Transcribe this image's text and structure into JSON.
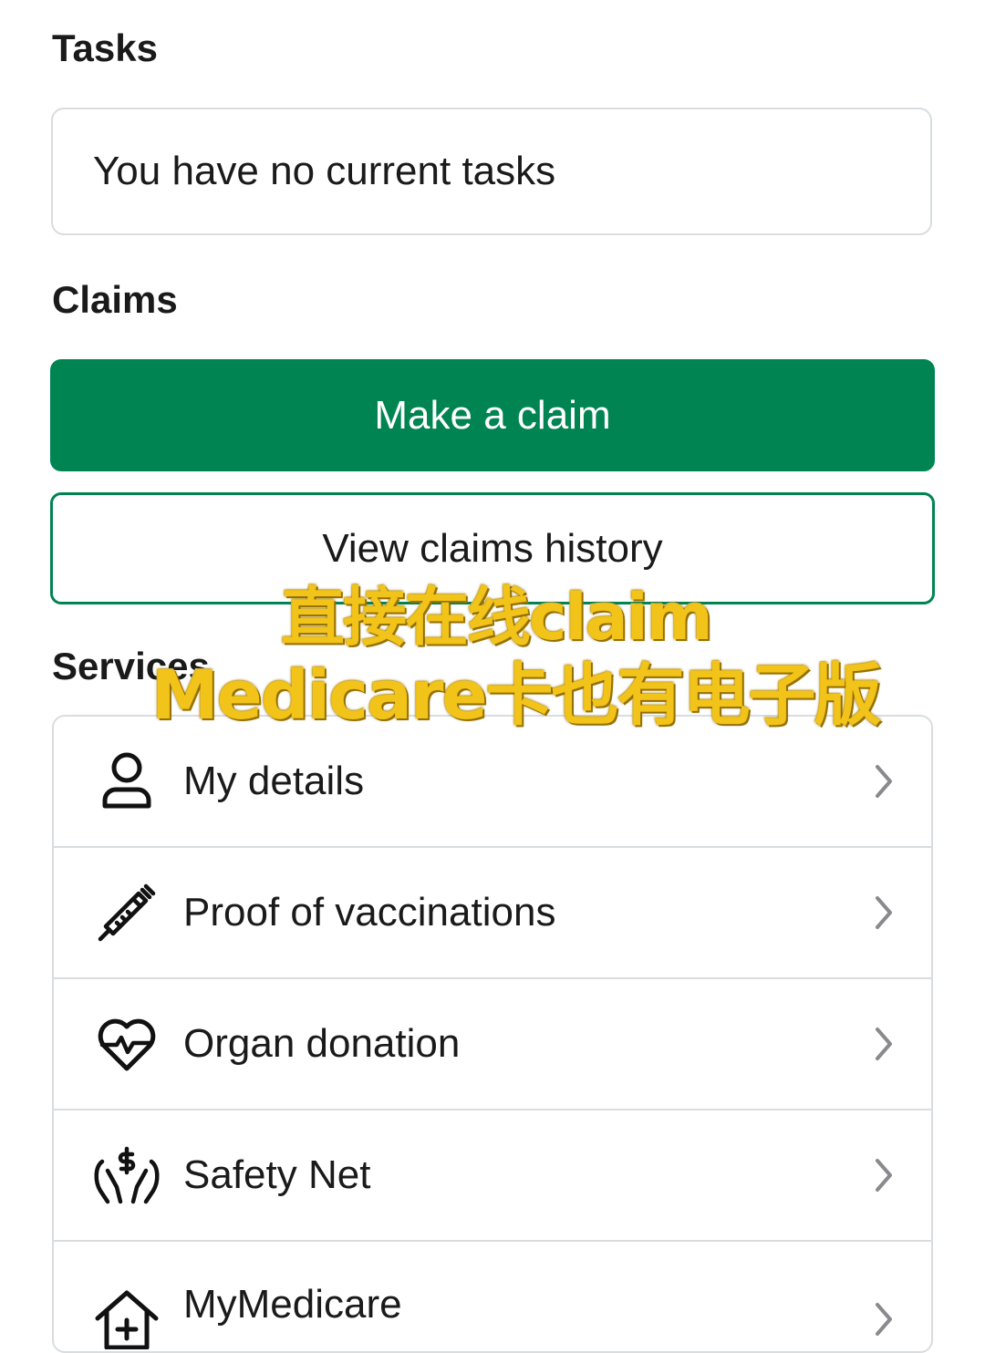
{
  "tasks": {
    "title": "Tasks",
    "empty_message": "You have no current tasks"
  },
  "claims": {
    "title": "Claims",
    "primary_button": "Make a claim",
    "secondary_button": "View claims history"
  },
  "services": {
    "title": "Services",
    "items": [
      {
        "label": "My details",
        "icon": "user-icon"
      },
      {
        "label": "Proof of vaccinations",
        "icon": "syringe-icon"
      },
      {
        "label": "Organ donation",
        "icon": "heart-pulse-icon"
      },
      {
        "label": "Safety Net",
        "icon": "hands-dollar-icon"
      },
      {
        "label": "MyMedicare",
        "icon": "house-medical-icon"
      }
    ]
  },
  "overlay": {
    "line1": "直接在线claim",
    "line2": "Medicare卡也有电子版"
  },
  "colors": {
    "accent": "#008452",
    "border": "#d9dde0",
    "overlay_text": "#f2c318"
  }
}
